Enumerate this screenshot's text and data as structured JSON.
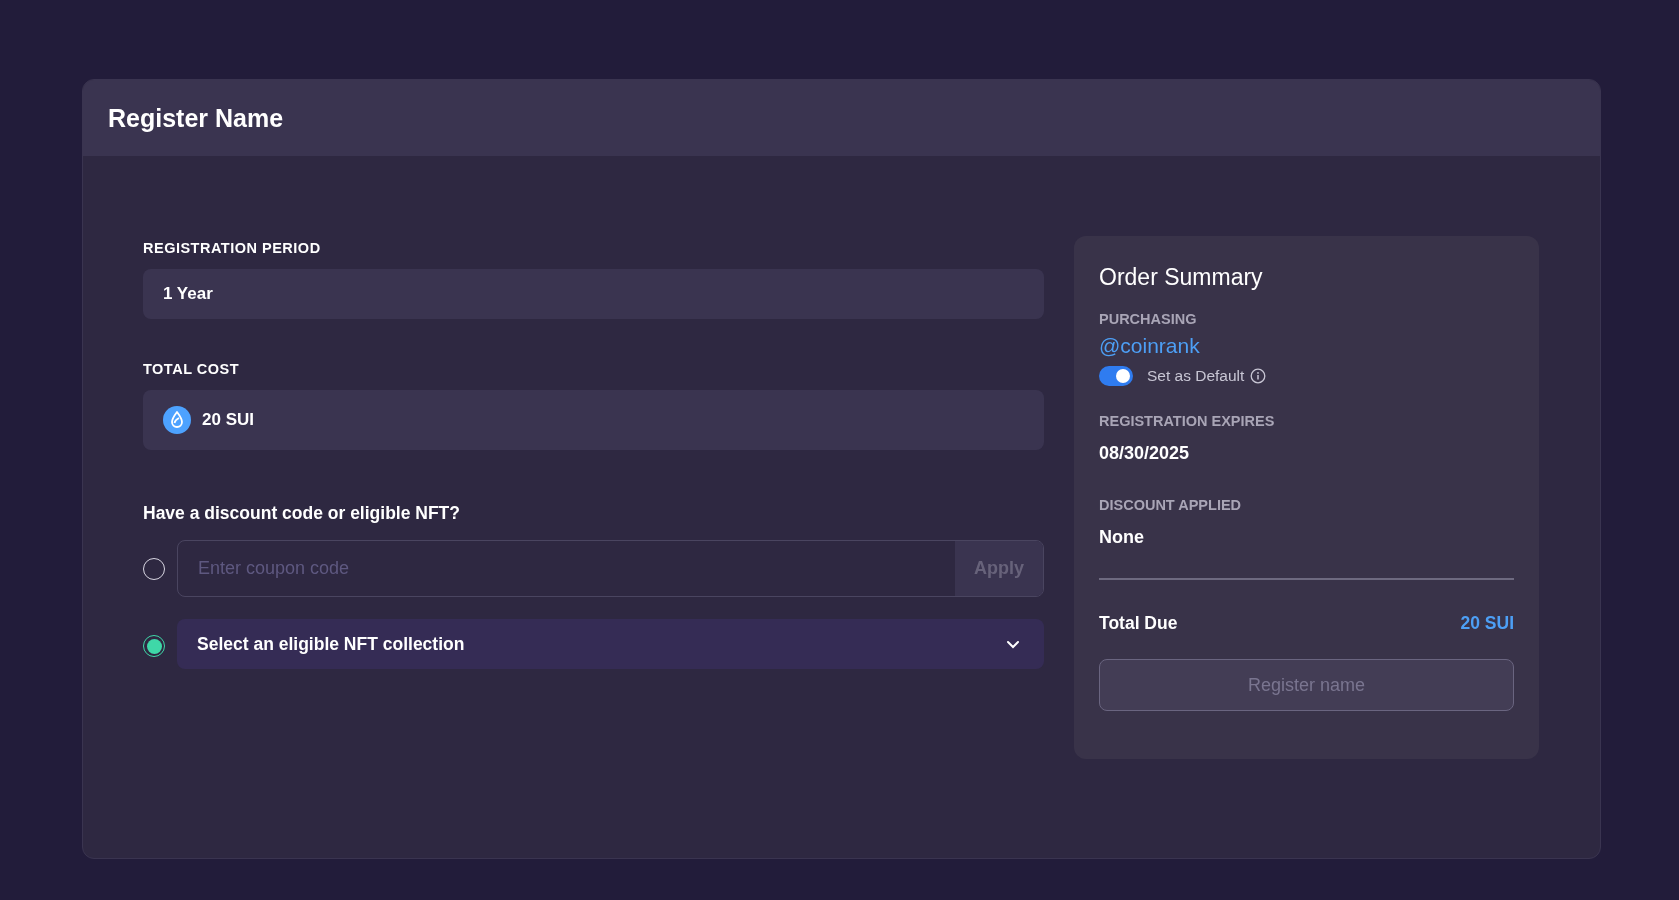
{
  "card": {
    "title": "Register Name"
  },
  "registration_period": {
    "label": "REGISTRATION PERIOD",
    "value": "1 Year"
  },
  "total_cost": {
    "label": "TOTAL COST",
    "value": "20 SUI"
  },
  "discount": {
    "question": "Have a discount code or eligible NFT?",
    "options": [
      {
        "kind": "coupon",
        "selected": false,
        "placeholder": "Enter coupon code",
        "button": "Apply",
        "disabled": true
      },
      {
        "kind": "nft",
        "selected": true,
        "value": "Select an eligible NFT collection"
      }
    ]
  },
  "order_summary": {
    "title": "Order Summary",
    "purchasing_label": "PURCHASING",
    "name": "@coinrank",
    "default_toggle": {
      "label": "Set as Default",
      "on": true
    },
    "expires_label": "REGISTRATION EXPIRES",
    "expires": "08/30/2025",
    "discount_label": "DISCOUNT APPLIED",
    "discount": "None",
    "total_label": "Total Due",
    "total": "20 SUI",
    "register_button": {
      "label": "Register name",
      "disabled": true
    }
  }
}
